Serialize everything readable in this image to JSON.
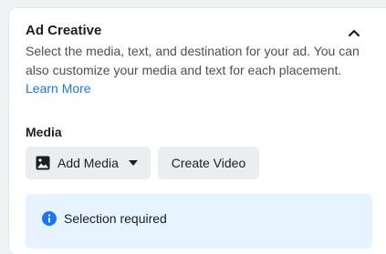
{
  "ad_creative": {
    "title": "Ad Creative",
    "description": "Select the media, text, and destination for your ad. You can also customize your media and text for each placement.",
    "learn_more": "Learn More",
    "collapse_icon": "chevron-up-icon"
  },
  "media": {
    "label": "Media",
    "add_media_label": "Add Media",
    "create_video_label": "Create Video",
    "add_media_icon": "image-icon",
    "dropdown_icon": "caret-down-icon"
  },
  "notice": {
    "icon": "info-icon",
    "text": "Selection required",
    "icon_color": "#1877f2",
    "background": "#e7f3ff"
  },
  "colors": {
    "link": "#1877f2",
    "button_bg": "#ebedf0"
  }
}
